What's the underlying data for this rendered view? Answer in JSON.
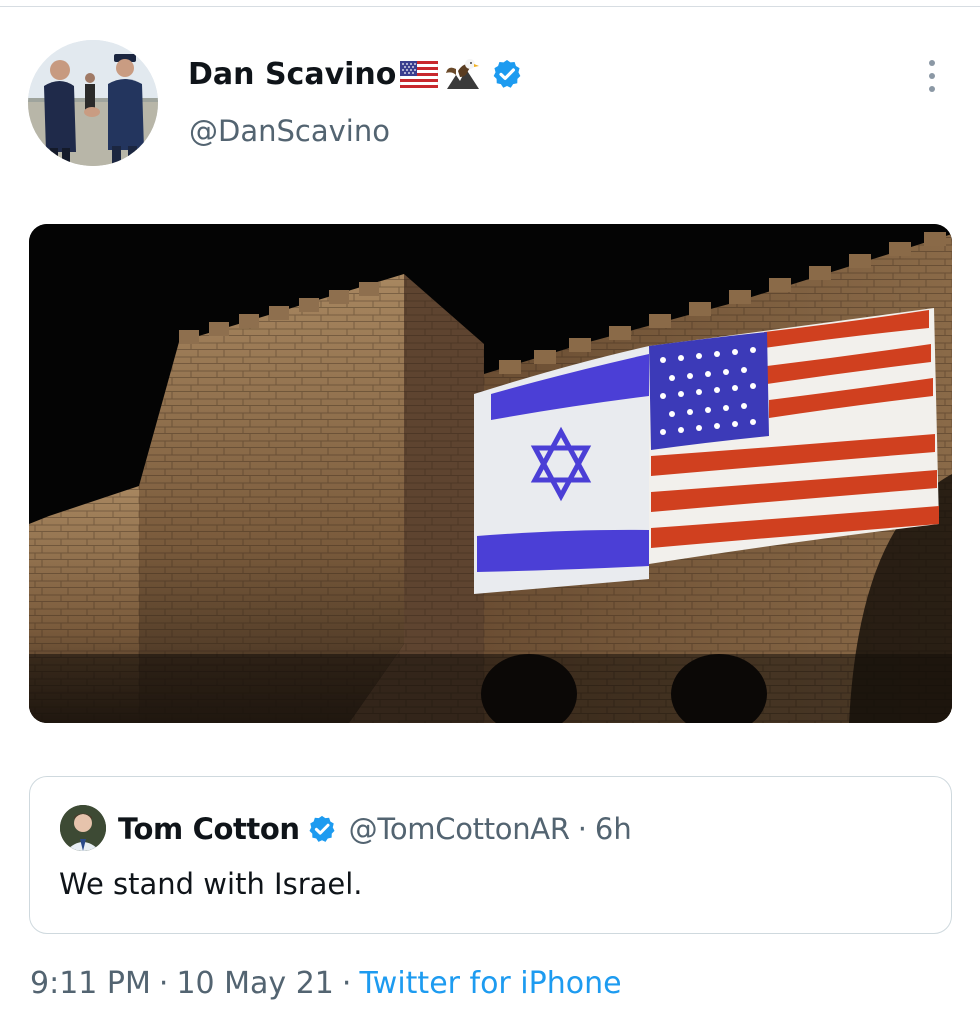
{
  "tweet": {
    "author": {
      "display_name": "Dan Scavino",
      "name_emojis": [
        "us-flag-emoji",
        "eagle-emoji"
      ],
      "handle": "@DanScavino",
      "verified": true
    },
    "media": {
      "image_semantic": "photo"
    },
    "quoted_tweet": {
      "display_name": "Tom Cotton",
      "handle": "@TomCottonAR",
      "separator": "·",
      "time": "6h",
      "text": "We stand with Israel.",
      "verified": true
    },
    "meta": {
      "time": "9:11 PM",
      "separator_1": "·",
      "date": "10 May 21",
      "separator_2": "·",
      "source": "Twitter for iPhone"
    }
  },
  "colors": {
    "verified_blue": "#1d9bf0",
    "link_blue": "#1d9bf0",
    "secondary_text": "#536471",
    "border": "#cfd9de"
  },
  "icons": {
    "verified": "verified-badge-icon",
    "more": "more-vertical-icon"
  }
}
